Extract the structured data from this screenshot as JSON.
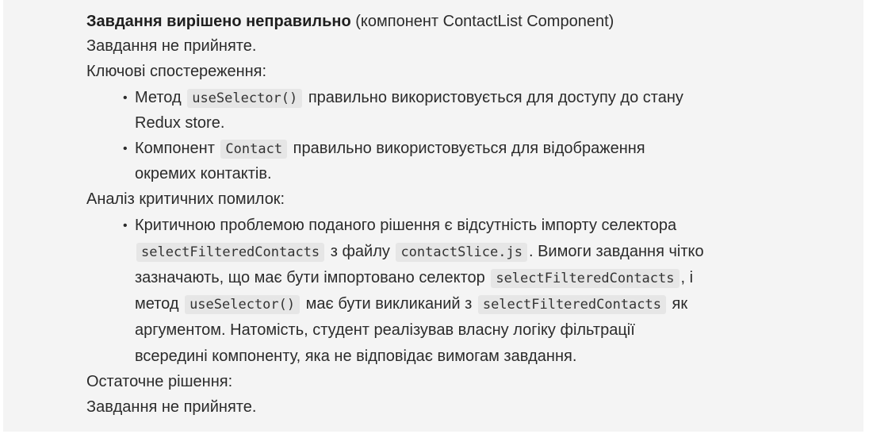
{
  "title_bold": "Завдання вирішено неправильно",
  "title_rest": " (компонент ContactList Component)",
  "status_1": "Завдання не прийняте.",
  "observations_heading": "Ключові спостереження:",
  "obs1": {
    "bullet": "•",
    "pre": "Метод ",
    "code": "useSelector()",
    "post": " правильно використовується для доступу до стану",
    "line2": "Redux store."
  },
  "obs2": {
    "bullet": "•",
    "pre": "Компонент ",
    "code": "Contact",
    "post": " правильно використовується для відображення",
    "line2": "окремих контактів."
  },
  "analysis_heading": "Аналіз критичних помилок:",
  "err1": {
    "bullet": "•",
    "l1": "Критичною проблемою поданого рішення є відсутність імпорту селектора",
    "l2_code1": "selectFilteredContacts",
    "l2_text1": " з файлу ",
    "l2_code2": "contactSlice.js",
    "l2_text2": ". Вимоги завдання чітко",
    "l3_text1": "зазначають, що має бути імпортовано селектор ",
    "l3_code1": "selectFilteredContacts",
    "l3_text2": ", і",
    "l4_text1": "метод ",
    "l4_code1": "useSelector()",
    "l4_text2": " має бути викликаний з ",
    "l4_code2": "selectFilteredContacts",
    "l4_text3": " як",
    "l5": "аргументом. Натомість, студент реалізував власну логіку фільтрації",
    "l6": "всередині компоненту, яка не відповідає вимогам завдання."
  },
  "final_heading": "Остаточне рішення:",
  "status_2": "Завдання не прийняте."
}
